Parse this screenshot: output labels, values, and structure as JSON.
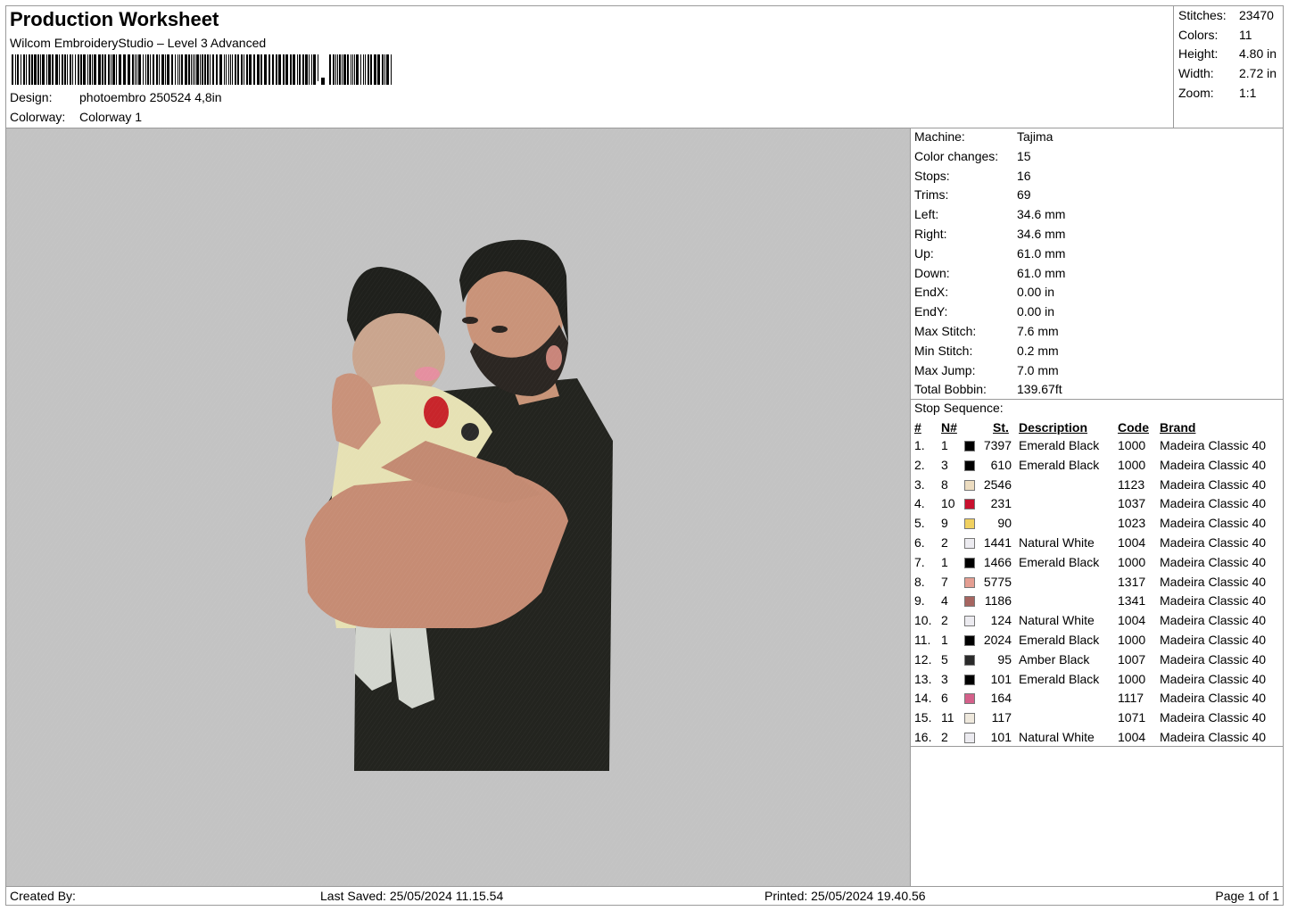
{
  "header": {
    "title": "Production Worksheet",
    "subtitle": "Wilcom EmbroideryStudio – Level 3 Advanced",
    "design_label": "Design:",
    "design_value": "photoembro 250524 4,8in",
    "colorway_label": "Colorway:",
    "colorway_value": "Colorway 1"
  },
  "summary": [
    {
      "label": "Stitches:",
      "value": "23470"
    },
    {
      "label": "Colors:",
      "value": "11"
    },
    {
      "label": "Height:",
      "value": "4.80 in"
    },
    {
      "label": "Width:",
      "value": "2.72 in"
    },
    {
      "label": "Zoom:",
      "value": "1:1"
    }
  ],
  "machine": [
    {
      "label": "Machine:",
      "value": "Tajima"
    },
    {
      "label": "Color changes:",
      "value": "15"
    },
    {
      "label": "Stops:",
      "value": "16"
    },
    {
      "label": "Trims:",
      "value": "69"
    },
    {
      "label": "Left:",
      "value": "34.6 mm"
    },
    {
      "label": "Right:",
      "value": "34.6 mm"
    },
    {
      "label": "Up:",
      "value": "61.0 mm"
    },
    {
      "label": "Down:",
      "value": "61.0 mm"
    },
    {
      "label": "EndX:",
      "value": "0.00 in"
    },
    {
      "label": "EndY:",
      "value": "0.00 in"
    },
    {
      "label": "Max Stitch:",
      "value": "7.6 mm"
    },
    {
      "label": "Min Stitch:",
      "value": "0.2 mm"
    },
    {
      "label": "Max Jump:",
      "value": "7.0 mm"
    },
    {
      "label": "Total Bobbin:",
      "value": "139.67ft"
    }
  ],
  "stop_sequence": {
    "title": "Stop Sequence:",
    "headers": {
      "idx": "#",
      "n": "N#",
      "st": "St.",
      "desc": "Description",
      "code": "Code",
      "brand": "Brand"
    },
    "rows": [
      {
        "idx": "1.",
        "n": "1",
        "color": "#000000",
        "st": "7397",
        "desc": "Emerald Black",
        "code": "1000",
        "brand": "Madeira Classic 40"
      },
      {
        "idx": "2.",
        "n": "3",
        "color": "#000000",
        "st": "610",
        "desc": "Emerald Black",
        "code": "1000",
        "brand": "Madeira Classic 40"
      },
      {
        "idx": "3.",
        "n": "8",
        "color": "#ecdcc0",
        "st": "2546",
        "desc": "",
        "code": "1123",
        "brand": "Madeira Classic 40"
      },
      {
        "idx": "4.",
        "n": "10",
        "color": "#c8102e",
        "st": "231",
        "desc": "",
        "code": "1037",
        "brand": "Madeira Classic 40"
      },
      {
        "idx": "5.",
        "n": "9",
        "color": "#f0d060",
        "st": "90",
        "desc": "",
        "code": "1023",
        "brand": "Madeira Classic 40"
      },
      {
        "idx": "6.",
        "n": "2",
        "color": "#ecebf0",
        "st": "1441",
        "desc": "Natural White",
        "code": "1004",
        "brand": "Madeira Classic 40"
      },
      {
        "idx": "7.",
        "n": "1",
        "color": "#000000",
        "st": "1466",
        "desc": "Emerald Black",
        "code": "1000",
        "brand": "Madeira Classic 40"
      },
      {
        "idx": "8.",
        "n": "7",
        "color": "#e49e92",
        "st": "5775",
        "desc": "",
        "code": "1317",
        "brand": "Madeira Classic 40"
      },
      {
        "idx": "9.",
        "n": "4",
        "color": "#a66560",
        "st": "1186",
        "desc": "",
        "code": "1341",
        "brand": "Madeira Classic 40"
      },
      {
        "idx": "10.",
        "n": "2",
        "color": "#ecebf0",
        "st": "124",
        "desc": "Natural White",
        "code": "1004",
        "brand": "Madeira Classic 40"
      },
      {
        "idx": "11.",
        "n": "1",
        "color": "#000000",
        "st": "2024",
        "desc": "Emerald Black",
        "code": "1000",
        "brand": "Madeira Classic 40"
      },
      {
        "idx": "12.",
        "n": "5",
        "color": "#2a2a2a",
        "st": "95",
        "desc": "Amber Black",
        "code": "1007",
        "brand": "Madeira Classic 40"
      },
      {
        "idx": "13.",
        "n": "3",
        "color": "#000000",
        "st": "101",
        "desc": "Emerald Black",
        "code": "1000",
        "brand": "Madeira Classic 40"
      },
      {
        "idx": "14.",
        "n": "6",
        "color": "#d4608a",
        "st": "164",
        "desc": "",
        "code": "1117",
        "brand": "Madeira Classic 40"
      },
      {
        "idx": "15.",
        "n": "11",
        "color": "#eee8dc",
        "st": "117",
        "desc": "",
        "code": "1071",
        "brand": "Madeira Classic 40"
      },
      {
        "idx": "16.",
        "n": "2",
        "color": "#ecebf0",
        "st": "101",
        "desc": "Natural White",
        "code": "1004",
        "brand": "Madeira Classic 40"
      }
    ]
  },
  "footer": {
    "created_by": "Created By:",
    "last_saved": "Last Saved: 25/05/2024 11.15.54",
    "printed": "Printed: 25/05/2024 19.40.56",
    "page": "Page 1 of 1"
  },
  "colors": {
    "preview_background": "#c3c3c3",
    "border": "#9a9a9a"
  }
}
